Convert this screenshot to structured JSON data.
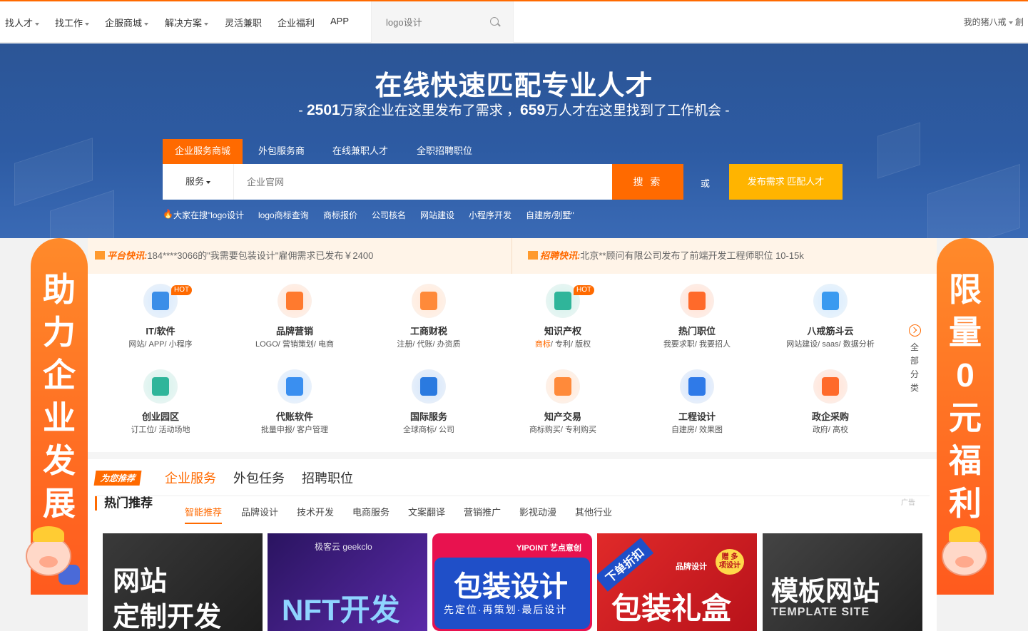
{
  "topnav": {
    "items": [
      {
        "label": "找人才",
        "dropdown": true
      },
      {
        "label": "找工作",
        "dropdown": true
      },
      {
        "label": "企服商城",
        "dropdown": true
      },
      {
        "label": "解决方案",
        "dropdown": true
      },
      {
        "label": "灵活兼职",
        "dropdown": false
      },
      {
        "label": "企业福利",
        "dropdown": false
      },
      {
        "label": "APP",
        "dropdown": false
      }
    ],
    "search_placeholder": "logo设计",
    "user": "我的猪八戒",
    "user_extra": "創"
  },
  "banner": {
    "title": "在线快速匹配专业人才",
    "sub_prefix": "- ",
    "sub_num1": "2501",
    "sub_mid1": "万家企业在这里发布了需求 ，",
    "sub_num2": "659",
    "sub_mid2": "万人才在这里找到了工作机会",
    "sub_suffix": " -",
    "tabs": [
      "企业服务商城",
      "外包服务商",
      "在线兼职人才",
      "全职招聘职位"
    ],
    "search_select": "服务",
    "search_placeholder": "企业官网",
    "search_button": "搜 索",
    "or_text": "或",
    "publish_button": "发布需求 匹配人才",
    "hotwords": [
      "大家在搜\"logo设计",
      "logo商标查询",
      "商标报价",
      "公司核名",
      "网站建设",
      "小程序开发",
      "自建房/别墅\""
    ]
  },
  "side_left_text": "助力企业发展",
  "side_right_text": "限量0元福利",
  "flash": {
    "left_tag": "平台快讯:",
    "left_text": "184****3066的\"我需要包装设计\"雇佣需求已发布￥2400",
    "right_tag": "招聘快讯:",
    "right_text": "北京**顾问有限公司发布了前端开发工程师职位 10-15k"
  },
  "categories": [
    {
      "name": "IT/软件",
      "desc": "网站/ APP/ 小程序",
      "hot": "HOT",
      "color": "#3b8ee8"
    },
    {
      "name": "品牌营销",
      "desc": "LOGO/ 营销策划/ 电商",
      "hot": "",
      "color": "#ff7a2e"
    },
    {
      "name": "工商财税",
      "desc": "注册/ 代账/ 办资质",
      "hot": "",
      "color": "#ff8a3a"
    },
    {
      "name": "知识产权",
      "desc_hl": "商标",
      "desc": "/ 专利/ 版权",
      "hot": "HOT",
      "color": "#2fb59a"
    },
    {
      "name": "热门职位",
      "desc": "我要求职/ 我要招人",
      "hot": "",
      "color": "#ff6a2a"
    },
    {
      "name": "八戒筋斗云",
      "desc": "网站建设/ saas/ 数据分析",
      "hot": "",
      "color": "#3a9af0"
    },
    {
      "name": "创业园区",
      "desc": "订工位/ 活动场地",
      "hot": "",
      "color": "#2fb59a"
    },
    {
      "name": "代账软件",
      "desc": "批量申报/ 客户管理",
      "hot": "",
      "color": "#3a8ff0"
    },
    {
      "name": "国际服务",
      "desc": "全球商标/ 公司",
      "hot": "",
      "color": "#2a7ae0"
    },
    {
      "name": "知产交易",
      "desc": "商标购买/ 专利购买",
      "hot": "",
      "color": "#ff8a3a"
    },
    {
      "name": "工程设计",
      "desc": "自建房/ 效果图",
      "hot": "",
      "color": "#2f7ae8"
    },
    {
      "name": "政企采购",
      "desc": "政府/ 高校",
      "hot": "",
      "color": "#ff6a2a"
    }
  ],
  "all_categories": "全部分类",
  "recommend": {
    "badge": "为您推荐",
    "tabs": [
      "企业服务",
      "外包任务",
      "招聘职位"
    ],
    "hot_title": "热门推荐",
    "ad": "广告",
    "sub_tabs": [
      "智能推荐",
      "品牌设计",
      "技术开发",
      "电商服务",
      "文案翻译",
      "营销推广",
      "影视动漫",
      "其他行业"
    ]
  },
  "cards": [
    {
      "line1": "网站",
      "line2": "定制开发",
      "bg": "#2b2b2b"
    },
    {
      "brand": "极客云 geekclo",
      "line1": "NFT开发",
      "bg": "#3a1a6e"
    },
    {
      "brand": "YIPOINT 艺点意创",
      "line1": "包装设计",
      "line2": "先定位·再策划·最后设计",
      "bg": "#1f4fc8"
    },
    {
      "ribbon": "下单折扣",
      "brand": "品牌设计",
      "gift": "赠 多项设计",
      "line1": "包装礼盒",
      "bg": "#d91f26"
    },
    {
      "line1": "模板网站",
      "line2": "TEMPLATE SITE",
      "bg": "#333"
    }
  ]
}
